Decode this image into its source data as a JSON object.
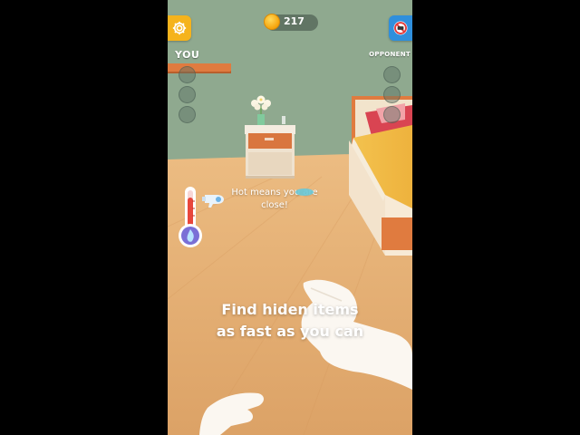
{
  "hud": {
    "coins": "217",
    "you_label": "YOU",
    "opponent_label": "OPPONENT",
    "you_progress": 0.26
  },
  "hint": {
    "text": "Hot means you are close!"
  },
  "instruction": {
    "line1": "Find hiden items",
    "line2": "as fast as you can"
  },
  "icons": {
    "settings": "gear-icon",
    "no_ads": "no-ads-icon",
    "coin": "coin-icon",
    "thermometer": "thermometer-icon",
    "hair_dryer": "hair-dryer-icon"
  },
  "colors": {
    "wall": "#8fa98f",
    "floor": "#e0a86a",
    "accent_orange": "#e07b3f",
    "settings_button": "#f5b31c",
    "no_ads_button": "#2f8fdc"
  }
}
